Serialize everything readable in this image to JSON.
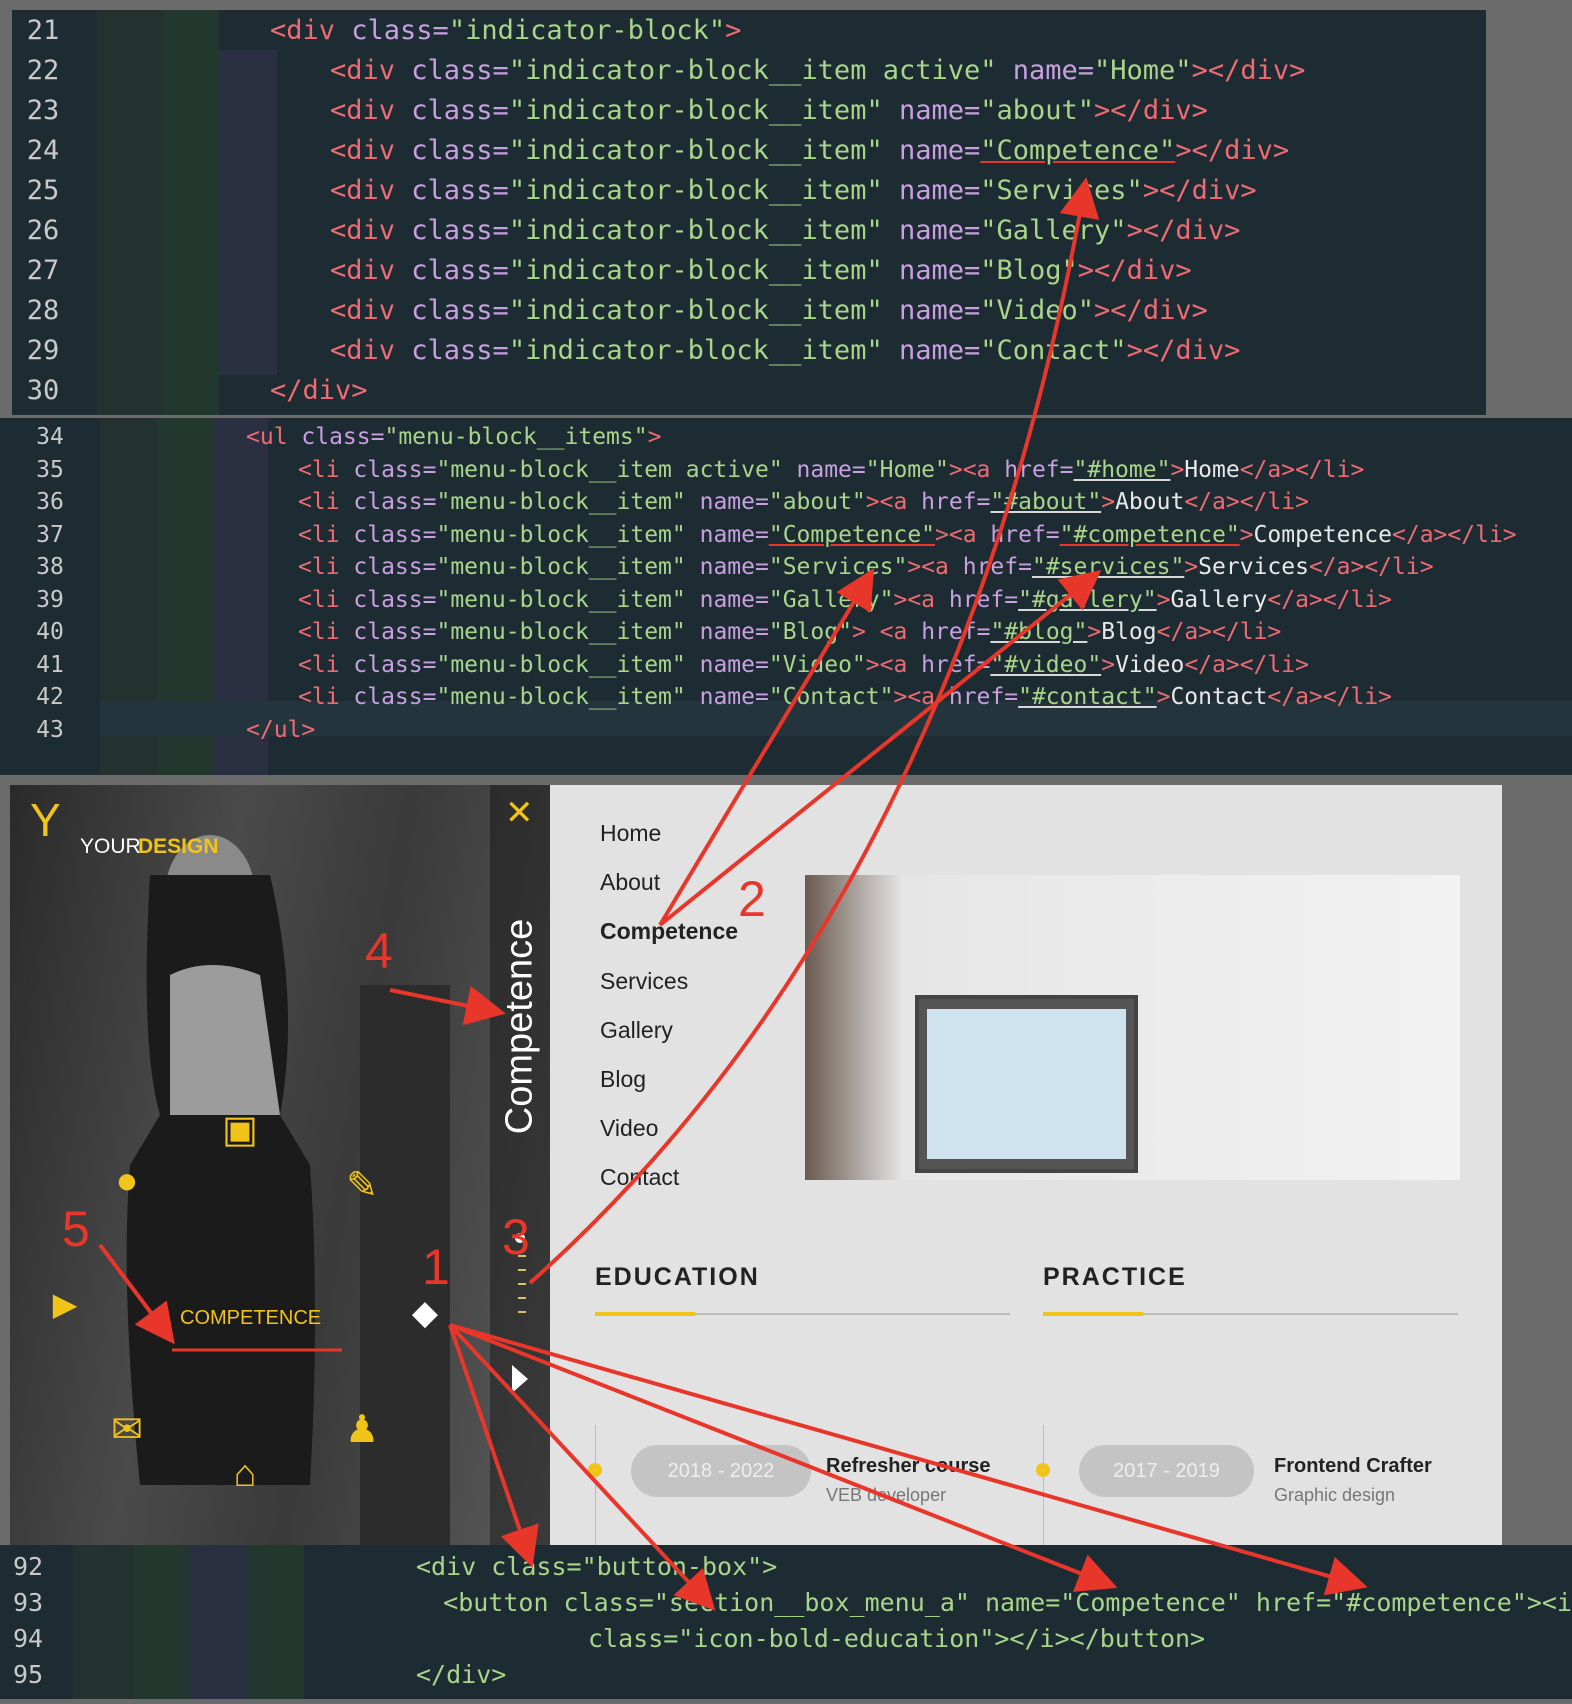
{
  "code_block_1": {
    "lines": [
      {
        "num": "21",
        "indent": 0,
        "kind": "open",
        "tag": "div",
        "class": "indicator-block",
        "name": null
      },
      {
        "num": "22",
        "indent": 1,
        "kind": "item",
        "tag": "div",
        "class": "indicator-block__item active",
        "name": "Home"
      },
      {
        "num": "23",
        "indent": 1,
        "kind": "item",
        "tag": "div",
        "class": "indicator-block__item",
        "name": "about"
      },
      {
        "num": "24",
        "indent": 1,
        "kind": "item",
        "tag": "div",
        "class": "indicator-block__item",
        "name": "Competence"
      },
      {
        "num": "25",
        "indent": 1,
        "kind": "item",
        "tag": "div",
        "class": "indicator-block__item",
        "name": "Services"
      },
      {
        "num": "26",
        "indent": 1,
        "kind": "item",
        "tag": "div",
        "class": "indicator-block__item",
        "name": "Gallery"
      },
      {
        "num": "27",
        "indent": 1,
        "kind": "item",
        "tag": "div",
        "class": "indicator-block__item",
        "name": "Blog"
      },
      {
        "num": "28",
        "indent": 1,
        "kind": "item",
        "tag": "div",
        "class": "indicator-block__item",
        "name": "Video"
      },
      {
        "num": "29",
        "indent": 1,
        "kind": "item",
        "tag": "div",
        "class": "indicator-block__item",
        "name": "Contact"
      },
      {
        "num": "30",
        "indent": 0,
        "kind": "close",
        "tag": "div"
      }
    ]
  },
  "code_block_2": {
    "lines": [
      {
        "num": "34",
        "indent": 0,
        "kind": "open",
        "tag": "ul",
        "class": "menu-block__items"
      },
      {
        "num": "35",
        "indent": 1,
        "kind": "li",
        "class": "menu-block__item active",
        "name": "Home",
        "href": "#home",
        "text": "Home"
      },
      {
        "num": "36",
        "indent": 1,
        "kind": "li",
        "class": "menu-block__item",
        "name": "about",
        "href": "#about",
        "text": "About"
      },
      {
        "num": "37",
        "indent": 1,
        "kind": "li",
        "class": "menu-block__item",
        "name": "Competence",
        "href": "#competence",
        "text": "Competence"
      },
      {
        "num": "38",
        "indent": 1,
        "kind": "li",
        "class": "menu-block__item",
        "name": "Services",
        "href": "#services",
        "text": "Services"
      },
      {
        "num": "39",
        "indent": 1,
        "kind": "li",
        "class": "menu-block__item",
        "name": "Gallery",
        "href": "#gallery",
        "text": "Gallery"
      },
      {
        "num": "40",
        "indent": 1,
        "kind": "li",
        "class": "menu-block__item",
        "name": "Blog",
        "href": "#blog",
        "text": "Blog",
        "space_before_a": true
      },
      {
        "num": "41",
        "indent": 1,
        "kind": "li",
        "class": "menu-block__item",
        "name": "Video",
        "href": "#video",
        "text": "Video"
      },
      {
        "num": "42",
        "indent": 1,
        "kind": "li",
        "class": "menu-block__item",
        "name": "Contact",
        "href": "#contact",
        "text": "Contact",
        "current": true
      },
      {
        "num": "43",
        "indent": 0,
        "kind": "close",
        "tag": "ul"
      }
    ]
  },
  "code_block_3": {
    "lines": [
      {
        "num": "92",
        "text": "<div class=\"button-box\">"
      },
      {
        "num": "93",
        "text": "<button class=\"section__box_menu_a\" name=\"Competence\" href=\"#competence\"><i"
      },
      {
        "num": "94",
        "text": "class=\"icon-bold-education\"></i></button>"
      },
      {
        "num": "95",
        "text": "</div>"
      }
    ]
  },
  "site": {
    "logo": {
      "part1": "YOUR",
      "part2": "DESIGN"
    },
    "vertical_title": "Competence",
    "menu_label": "COMPETENCE",
    "nav": [
      "Home",
      "About",
      "Competence",
      "Services",
      "Gallery",
      "Blog",
      "Video",
      "Contact"
    ],
    "nav_active": "Competence",
    "tabs": {
      "education": "EDUCATION",
      "practice": "PRACTICE"
    },
    "education": {
      "years": "2018 - 2022",
      "title": "Refresher course",
      "subtitle": "VEB developer"
    },
    "practice": {
      "years": "2017 - 2019",
      "title": "Frontend Crafter",
      "subtitle": "Graphic design"
    },
    "annotations": [
      "1",
      "2",
      "3",
      "4",
      "5"
    ],
    "colors": {
      "accent": "#f0c419",
      "arrow": "#e8362b",
      "panel": "#e2e2e2",
      "code_bg": "#1d2b33"
    }
  }
}
